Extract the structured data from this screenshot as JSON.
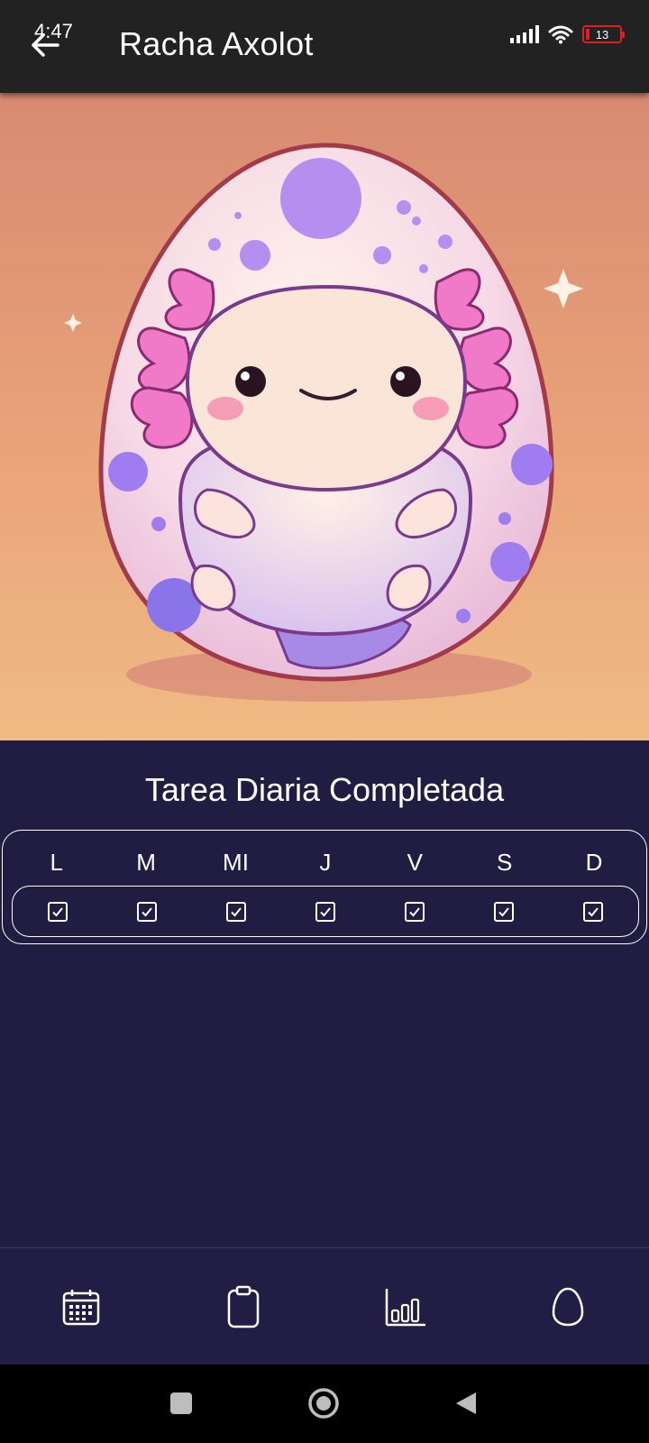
{
  "status_bar": {
    "time": "4:47",
    "battery_level": "13"
  },
  "app_bar": {
    "title": "Racha Axolot"
  },
  "hero": {
    "image": "axolotl-egg-illustration"
  },
  "streak": {
    "title": "Tarea Diaria Completada",
    "days": [
      {
        "label": "L",
        "checked": true
      },
      {
        "label": "M",
        "checked": true
      },
      {
        "label": "MI",
        "checked": true
      },
      {
        "label": "J",
        "checked": true
      },
      {
        "label": "V",
        "checked": true
      },
      {
        "label": "S",
        "checked": true
      },
      {
        "label": "D",
        "checked": true
      }
    ]
  },
  "bottom_nav": [
    {
      "icon": "calendar-icon"
    },
    {
      "icon": "clipboard-icon"
    },
    {
      "icon": "bar-chart-icon"
    },
    {
      "icon": "egg-icon"
    }
  ],
  "system_nav": [
    "recents-icon",
    "home-icon",
    "back-icon"
  ],
  "colors": {
    "background": "#211d42",
    "app_bar": "#222222",
    "accent": "#ffffff"
  }
}
